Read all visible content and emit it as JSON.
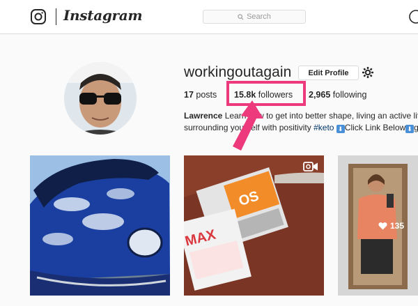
{
  "header": {
    "wordmark": "Instagram",
    "search_placeholder": "Search"
  },
  "profile": {
    "username": "workingoutagain",
    "edit_button": "Edit Profile",
    "stats": {
      "posts_count": "17",
      "posts_label": "posts",
      "followers_count": "15.8k",
      "followers_label": "followers",
      "following_count": "2,965",
      "following_label": "following"
    },
    "bio": {
      "name": "Lawrence",
      "line1_rest": "Learn how to get into better shape, living an active life",
      "line2_text": "surrounding yourself with positivity",
      "hashtag": "#keto",
      "cta": "Click Link Below",
      "trailing": "go"
    }
  },
  "posts": [
    {
      "name": "post-blue-car",
      "subject": "blue sports car"
    },
    {
      "name": "post-supplement-box",
      "subject": "supplement packets on table",
      "is_video": true
    },
    {
      "name": "post-before-photo",
      "subject": "mirror selfie",
      "likes": "135"
    }
  ],
  "colors": {
    "highlight": "#ec3a7c",
    "accent_link": "#003569"
  },
  "icons": [
    "instagram-glyph-icon",
    "search-icon",
    "gear-icon",
    "video-camera-icon",
    "heart-icon",
    "arrow-annotation"
  ]
}
